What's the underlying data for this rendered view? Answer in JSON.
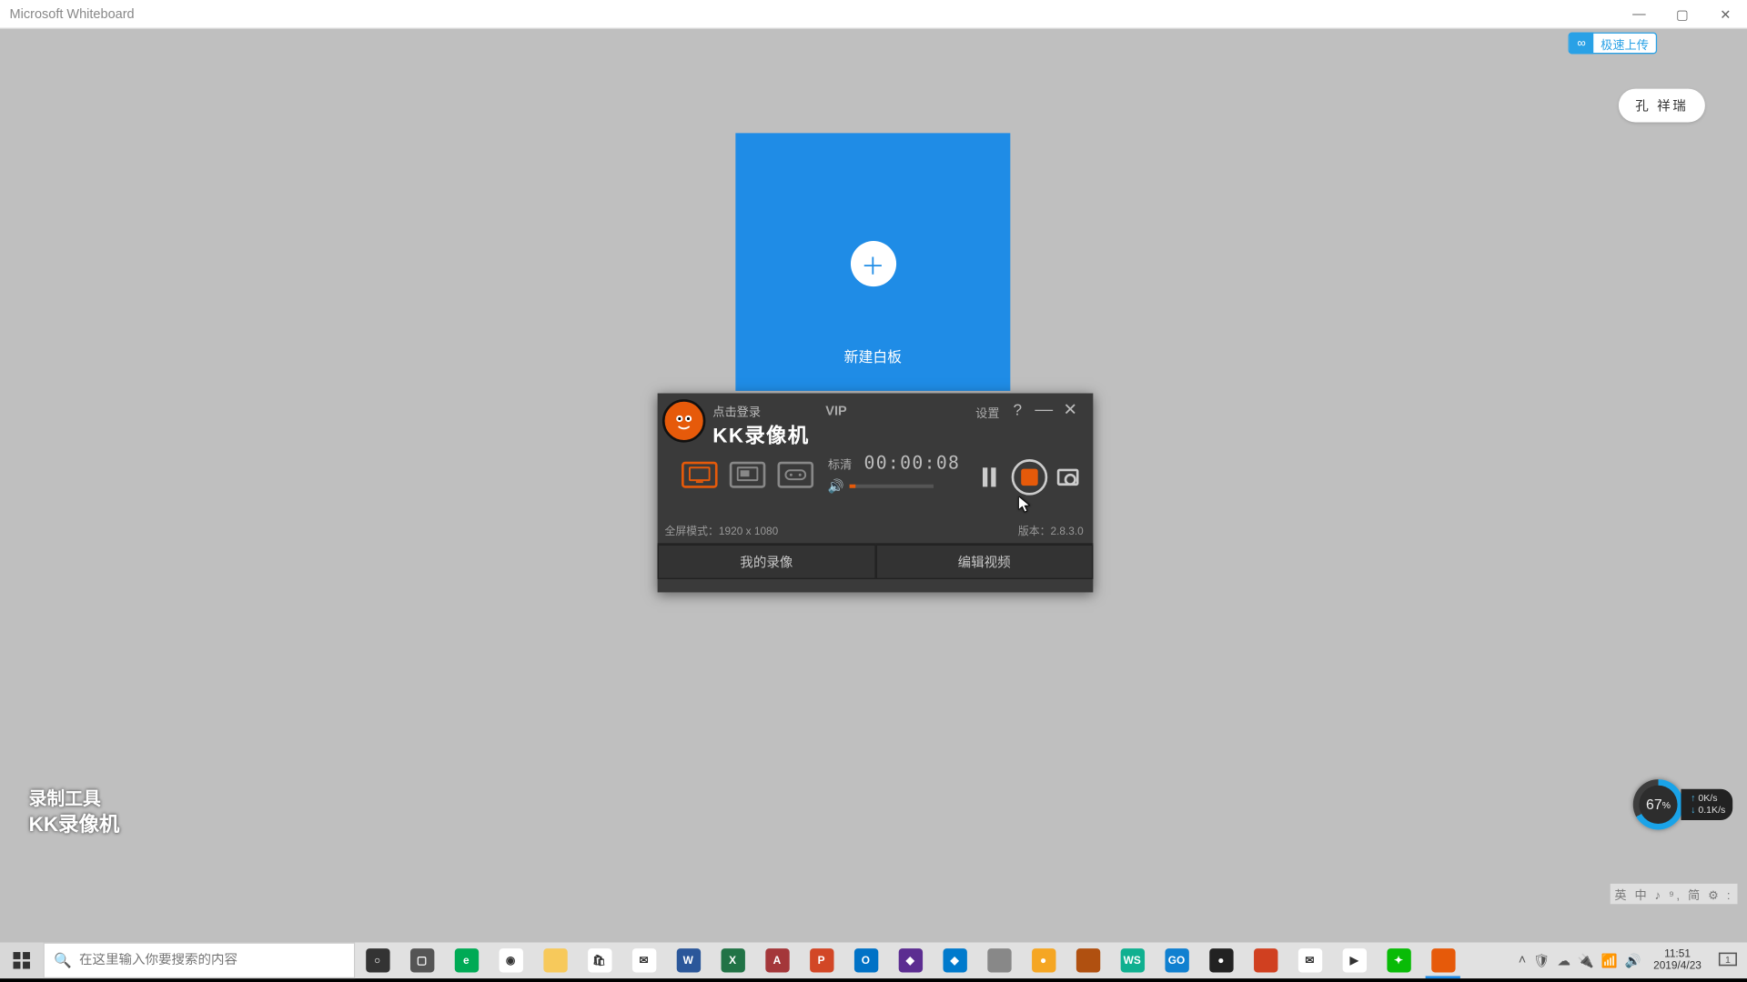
{
  "whiteboard": {
    "title": "Microsoft Whiteboard",
    "cloud_button": "极速上传",
    "user": "孔 祥瑞",
    "new_board": "新建白板"
  },
  "watermark": {
    "line1": "录制工具",
    "line2": "KK录像机"
  },
  "kk": {
    "login": "点击登录",
    "name": "KK录像机",
    "vip": "VIP",
    "settings": "设置",
    "quality": "标清",
    "timer": "00:00:08",
    "mode_label": "全屏模式：",
    "mode_value": "1920 x 1080",
    "version_label": "版本：",
    "version_value": "2.8.3.0",
    "tab_my": "我的录像",
    "tab_edit": "编辑视频"
  },
  "gauge": {
    "pct": "67",
    "pct_suffix": "%",
    "up": "0K/s",
    "down": "0.1K/s"
  },
  "ime": "英 中 ♪ ⁹, 简 ⚙ :",
  "taskbar": {
    "search_placeholder": "在这里输入你要搜索的内容",
    "apps": [
      {
        "name": "cortana",
        "bg": "#333",
        "txt": "○"
      },
      {
        "name": "taskview",
        "bg": "#555",
        "txt": "▢"
      },
      {
        "name": "edge",
        "bg": "#0a5",
        "txt": "e"
      },
      {
        "name": "chrome",
        "bg": "#fff",
        "txt": "◉"
      },
      {
        "name": "explorer",
        "bg": "#f7c95b",
        "txt": ""
      },
      {
        "name": "store",
        "bg": "#fff",
        "txt": "🛍"
      },
      {
        "name": "mail",
        "bg": "#fff",
        "txt": "✉"
      },
      {
        "name": "word",
        "bg": "#2b579a",
        "txt": "W"
      },
      {
        "name": "excel",
        "bg": "#217346",
        "txt": "X"
      },
      {
        "name": "access",
        "bg": "#a4373a",
        "txt": "A"
      },
      {
        "name": "powerpoint",
        "bg": "#d24726",
        "txt": "P"
      },
      {
        "name": "outlook",
        "bg": "#0072c6",
        "txt": "O"
      },
      {
        "name": "visualstudio",
        "bg": "#5c2d91",
        "txt": "◆"
      },
      {
        "name": "vscode",
        "bg": "#007acc",
        "txt": "◆"
      },
      {
        "name": "app1",
        "bg": "#888",
        "txt": ""
      },
      {
        "name": "coin",
        "bg": "#f5a623",
        "txt": "●"
      },
      {
        "name": "app2",
        "bg": "#b05010",
        "txt": ""
      },
      {
        "name": "webstorm",
        "bg": "#10b090",
        "txt": "WS"
      },
      {
        "name": "goland",
        "bg": "#1080d0",
        "txt": "GO"
      },
      {
        "name": "rec",
        "bg": "#222",
        "txt": "●"
      },
      {
        "name": "app3",
        "bg": "#d04020",
        "txt": ""
      },
      {
        "name": "app4",
        "bg": "#fff",
        "txt": "✉"
      },
      {
        "name": "app5",
        "bg": "#fff",
        "txt": "▶"
      },
      {
        "name": "wechat",
        "bg": "#09bb07",
        "txt": "✦"
      },
      {
        "name": "kk",
        "bg": "#e65a0a",
        "txt": ""
      }
    ],
    "active_index": 24,
    "time": "11:51",
    "date": "2019/4/23",
    "notif_count": "1"
  }
}
